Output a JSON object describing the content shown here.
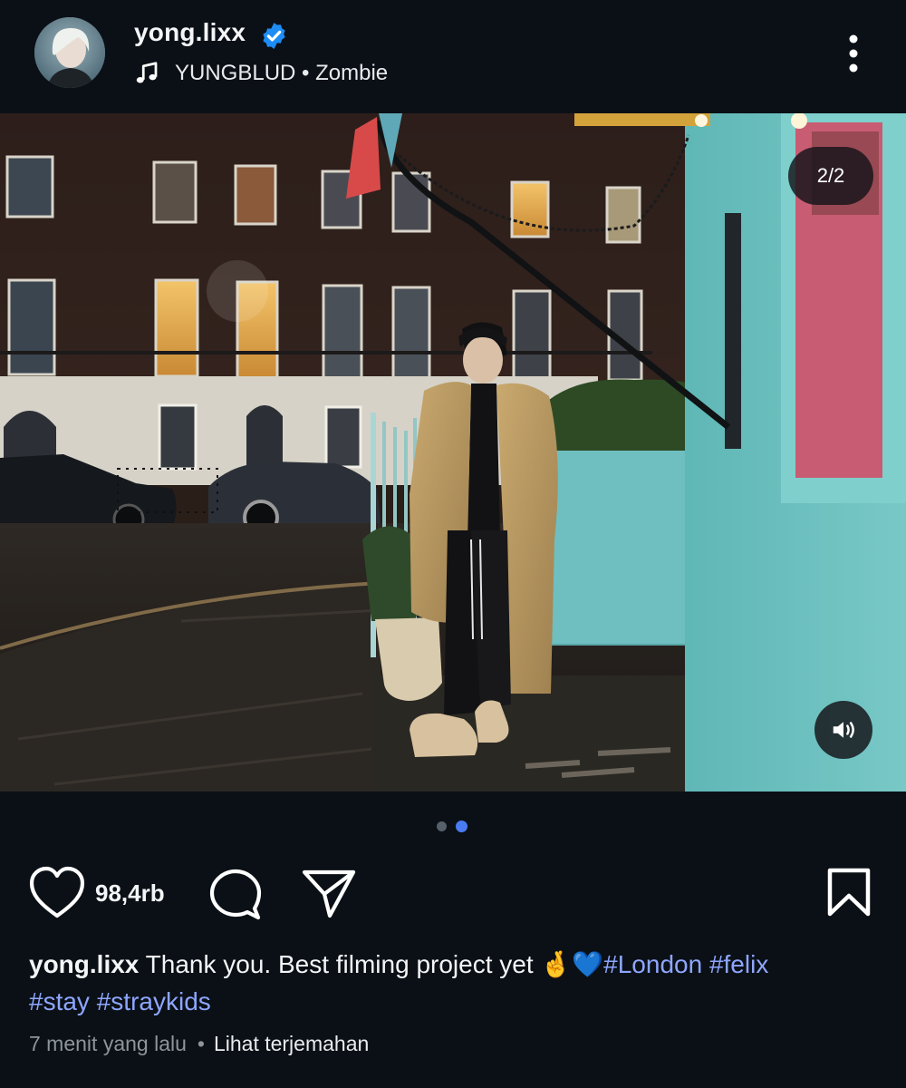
{
  "post": {
    "username": "yong.lixx",
    "verified": true,
    "music": {
      "artist": "YUNGBLUD",
      "separator": "•",
      "song": "Zombie"
    },
    "carousel": {
      "counter": "2/2",
      "total": 2,
      "current": 2
    },
    "likes": "98,4rb",
    "caption": {
      "username": "yong.lixx",
      "text": "Thank you. Best filming project yet",
      "emojis": "🤞💙",
      "hashtags": [
        "#London",
        "#felix",
        "#stay",
        "#straykids"
      ]
    },
    "time_ago": "7 menit yang lalu",
    "meta_separator": "•",
    "translate_label": "Lihat terjemahan"
  },
  "icons": {
    "verified": "verified-badge-icon",
    "music": "music-note-icon",
    "more": "more-vertical-icon",
    "sound": "speaker-icon",
    "like": "heart-icon",
    "comment": "comment-bubble-icon",
    "share": "paper-plane-icon",
    "save": "bookmark-icon"
  },
  "colors": {
    "background": "#0b1016",
    "verified": "#1d8df5",
    "hashtag": "#8ea6ff",
    "active_dot": "#4a7bf0"
  }
}
